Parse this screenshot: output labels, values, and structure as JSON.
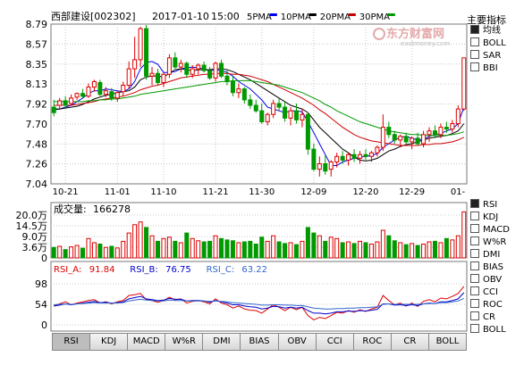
{
  "header": {
    "stock_title": "西部建设[002302]",
    "date": "2017-01-10",
    "time": "15:00",
    "ma_labels": [
      {
        "label": "5PMA",
        "color": "#0000ee"
      },
      {
        "label": "10PMA",
        "color": "#000000"
      },
      {
        "label": "20PMA",
        "color": "#cc0000"
      },
      {
        "label": "30PMA",
        "color": "#009900"
      }
    ],
    "watermark_cn": "东方财富网",
    "watermark_en": "eastmoney.com"
  },
  "indicator_panel": {
    "title": "主要指标",
    "items": [
      {
        "label": "均线",
        "checked": true
      },
      {
        "label": "BOLL",
        "checked": false
      },
      {
        "label": "SAR",
        "checked": false
      },
      {
        "label": "BBI",
        "checked": false
      }
    ]
  },
  "sub_indicator_panel": {
    "items": [
      {
        "label": "RSI",
        "checked": true
      },
      {
        "label": "KDJ",
        "checked": false
      },
      {
        "label": "MACD",
        "checked": false
      },
      {
        "label": "W%R",
        "checked": false
      },
      {
        "label": "DMI",
        "checked": false
      },
      {
        "label": "BIAS",
        "checked": false
      },
      {
        "label": "OBV",
        "checked": false
      },
      {
        "label": "CCI",
        "checked": false
      },
      {
        "label": "ROC",
        "checked": false
      },
      {
        "label": "CR",
        "checked": false
      },
      {
        "label": "BOLL",
        "checked": false
      }
    ]
  },
  "tabs": [
    "RSI",
    "KDJ",
    "MACD",
    "W%R",
    "DMI",
    "BIAS",
    "OBV",
    "CCI",
    "ROC",
    "CR",
    "BOLL"
  ],
  "active_tab": "RSI",
  "colors": {
    "up": "#dd0000",
    "down": "#009900",
    "grid": "#c8c8c8",
    "rsi_a": "#dd0000",
    "rsi_b": "#0000cc",
    "rsi_c": "#3366cc"
  },
  "chart_data": [
    {
      "type": "candlestick",
      "ylim": [
        7.04,
        8.79
      ],
      "y_ticks": [
        "8.79",
        "8.57",
        "8.35",
        "8.13",
        "7.92",
        "7.70",
        "7.48",
        "7.26",
        "7.04"
      ],
      "x_tick_labels": [
        "10-21",
        "11-01",
        "11-10",
        "11-21",
        "11-30",
        "12-09",
        "12-20",
        "12-29",
        "01-"
      ],
      "ohlc": [
        [
          7.88,
          7.96,
          7.78,
          7.82
        ],
        [
          7.9,
          7.98,
          7.85,
          7.95
        ],
        [
          7.95,
          8.0,
          7.86,
          7.9
        ],
        [
          7.92,
          8.02,
          7.9,
          7.98
        ],
        [
          7.99,
          8.04,
          7.96,
          8.03
        ],
        [
          8.03,
          8.08,
          7.98,
          8.0
        ],
        [
          8.0,
          8.14,
          7.98,
          8.1
        ],
        [
          8.1,
          8.18,
          8.05,
          8.16
        ],
        [
          8.15,
          8.18,
          8.0,
          8.02
        ],
        [
          8.02,
          8.1,
          7.99,
          8.06
        ],
        [
          8.05,
          8.09,
          7.95,
          7.98
        ],
        [
          7.98,
          8.06,
          7.94,
          8.04
        ],
        [
          8.05,
          8.16,
          8.0,
          8.12
        ],
        [
          8.12,
          8.38,
          8.08,
          8.3
        ],
        [
          8.3,
          8.65,
          8.2,
          8.4
        ],
        [
          8.4,
          8.76,
          8.32,
          8.74
        ],
        [
          8.74,
          8.78,
          8.18,
          8.22
        ],
        [
          8.22,
          8.32,
          8.12,
          8.25
        ],
        [
          8.25,
          8.3,
          8.12,
          8.15
        ],
        [
          8.15,
          8.26,
          8.1,
          8.24
        ],
        [
          8.24,
          8.46,
          8.2,
          8.42
        ],
        [
          8.42,
          8.48,
          8.3,
          8.32
        ],
        [
          8.32,
          8.4,
          8.26,
          8.36
        ],
        [
          8.36,
          8.38,
          8.2,
          8.24
        ],
        [
          8.24,
          8.34,
          8.2,
          8.3
        ],
        [
          8.3,
          8.36,
          8.24,
          8.34
        ],
        [
          8.34,
          8.38,
          8.26,
          8.28
        ],
        [
          8.28,
          8.32,
          8.18,
          8.2
        ],
        [
          8.2,
          8.38,
          8.16,
          8.36
        ],
        [
          8.36,
          8.4,
          8.2,
          8.22
        ],
        [
          8.22,
          8.28,
          8.12,
          8.16
        ],
        [
          8.16,
          8.22,
          8.0,
          8.04
        ],
        [
          8.04,
          8.14,
          7.98,
          8.08
        ],
        [
          8.08,
          8.1,
          7.92,
          7.96
        ],
        [
          7.96,
          8.02,
          7.86,
          7.9
        ],
        [
          7.9,
          7.96,
          7.82,
          7.84
        ],
        [
          7.84,
          7.92,
          7.7,
          7.72
        ],
        [
          7.72,
          7.82,
          7.68,
          7.8
        ],
        [
          7.8,
          7.96,
          7.76,
          7.92
        ],
        [
          7.92,
          7.98,
          7.84,
          7.88
        ],
        [
          7.88,
          7.94,
          7.72,
          7.76
        ],
        [
          7.76,
          7.88,
          7.68,
          7.84
        ],
        [
          7.84,
          7.92,
          7.7,
          7.74
        ],
        [
          7.74,
          7.86,
          7.66,
          7.8
        ],
        [
          7.8,
          7.82,
          7.36,
          7.42
        ],
        [
          7.42,
          7.48,
          7.18,
          7.2
        ],
        [
          7.2,
          7.34,
          7.12,
          7.26
        ],
        [
          7.26,
          7.36,
          7.14,
          7.18
        ],
        [
          7.2,
          7.3,
          7.12,
          7.28
        ],
        [
          7.28,
          7.38,
          7.22,
          7.34
        ],
        [
          7.34,
          7.4,
          7.26,
          7.3
        ],
        [
          7.3,
          7.38,
          7.24,
          7.36
        ],
        [
          7.36,
          7.42,
          7.28,
          7.32
        ],
        [
          7.32,
          7.4,
          7.26,
          7.36
        ],
        [
          7.36,
          7.42,
          7.3,
          7.34
        ],
        [
          7.34,
          7.4,
          7.28,
          7.38
        ],
        [
          7.38,
          7.46,
          7.34,
          7.44
        ],
        [
          7.44,
          7.8,
          7.4,
          7.66
        ],
        [
          7.66,
          7.72,
          7.54,
          7.58
        ],
        [
          7.58,
          7.62,
          7.48,
          7.52
        ],
        [
          7.52,
          7.58,
          7.44,
          7.56
        ],
        [
          7.56,
          7.6,
          7.48,
          7.5
        ],
        [
          7.5,
          7.56,
          7.42,
          7.54
        ],
        [
          7.54,
          7.6,
          7.46,
          7.48
        ],
        [
          7.48,
          7.62,
          7.44,
          7.58
        ],
        [
          7.58,
          7.66,
          7.5,
          7.62
        ],
        [
          7.62,
          7.68,
          7.54,
          7.58
        ],
        [
          7.58,
          7.7,
          7.54,
          7.66
        ],
        [
          7.66,
          7.72,
          7.6,
          7.64
        ],
        [
          7.64,
          7.74,
          7.6,
          7.7
        ],
        [
          7.7,
          7.9,
          7.66,
          7.86
        ],
        [
          7.86,
          8.42,
          7.84,
          8.42
        ]
      ],
      "ma_lines": {
        "5PMA": [
          7.85,
          7.86,
          7.88,
          7.9,
          7.94,
          7.98,
          8.03,
          8.06,
          8.06,
          8.08,
          8.07,
          8.06,
          8.05,
          8.08,
          8.16,
          8.3,
          8.37,
          8.38,
          8.35,
          8.26,
          8.26,
          8.27,
          8.3,
          8.31,
          8.32,
          8.31,
          8.3,
          8.28,
          8.29,
          8.28,
          8.26,
          8.22,
          8.16,
          8.12,
          8.08,
          8.02,
          7.96,
          7.88,
          7.86,
          7.84,
          7.82,
          7.84,
          7.84,
          7.83,
          7.72,
          7.6,
          7.48,
          7.36,
          7.24,
          7.24,
          7.28,
          7.3,
          7.32,
          7.33,
          7.34,
          7.35,
          7.37,
          7.44,
          7.48,
          7.52,
          7.55,
          7.56,
          7.54,
          7.52,
          7.53,
          7.56,
          7.58,
          7.59,
          7.62,
          7.64,
          7.7,
          7.88
        ],
        "10PMA": [
          7.86,
          7.86,
          7.87,
          7.88,
          7.89,
          7.91,
          7.94,
          7.97,
          7.99,
          8.01,
          8.02,
          8.04,
          8.05,
          8.06,
          8.1,
          8.18,
          8.21,
          8.22,
          8.22,
          8.21,
          8.25,
          8.29,
          8.3,
          8.29,
          8.28,
          8.29,
          8.29,
          8.29,
          8.3,
          8.3,
          8.29,
          8.27,
          8.24,
          8.21,
          8.18,
          8.14,
          8.1,
          8.06,
          8.02,
          7.98,
          7.94,
          7.9,
          7.88,
          7.86,
          7.82,
          7.74,
          7.66,
          7.6,
          7.54,
          7.48,
          7.42,
          7.38,
          7.33,
          7.3,
          7.29,
          7.3,
          7.32,
          7.36,
          7.4,
          7.42,
          7.45,
          7.47,
          7.48,
          7.5,
          7.52,
          7.54,
          7.55,
          7.56,
          7.57,
          7.59,
          7.62,
          7.7
        ],
        "20PMA": [
          7.9,
          7.9,
          7.9,
          7.9,
          7.91,
          7.92,
          7.93,
          7.94,
          7.96,
          7.97,
          7.98,
          7.99,
          8.0,
          8.02,
          8.04,
          8.07,
          8.09,
          8.11,
          8.12,
          8.14,
          8.16,
          8.18,
          8.2,
          8.21,
          8.22,
          8.23,
          8.24,
          8.24,
          8.25,
          8.25,
          8.25,
          8.24,
          8.24,
          8.23,
          8.22,
          8.2,
          8.18,
          8.16,
          8.13,
          8.1,
          8.07,
          8.04,
          8.01,
          7.98,
          7.94,
          7.9,
          7.85,
          7.81,
          7.76,
          7.71,
          7.66,
          7.62,
          7.58,
          7.55,
          7.53,
          7.51,
          7.5,
          7.49,
          7.48,
          7.47,
          7.46,
          7.46,
          7.46,
          7.46,
          7.47,
          7.47,
          7.48,
          7.48,
          7.49,
          7.5,
          7.52,
          7.55
        ],
        "30PMA": [
          7.94,
          7.94,
          7.94,
          7.94,
          7.94,
          7.94,
          7.95,
          7.95,
          7.96,
          7.96,
          7.97,
          7.97,
          7.98,
          7.99,
          8.0,
          8.02,
          8.03,
          8.04,
          8.05,
          8.06,
          8.07,
          8.08,
          8.09,
          8.1,
          8.11,
          8.12,
          8.13,
          8.14,
          8.15,
          8.16,
          8.16,
          8.17,
          8.17,
          8.17,
          8.17,
          8.16,
          8.15,
          8.14,
          8.13,
          8.12,
          8.1,
          8.08,
          8.06,
          8.04,
          8.01,
          7.98,
          7.95,
          7.91,
          7.88,
          7.84,
          7.81,
          7.78,
          7.75,
          7.72,
          7.7,
          7.68,
          7.66,
          7.64,
          7.62,
          7.61,
          7.6,
          7.59,
          7.58,
          7.58,
          7.57,
          7.57,
          7.57,
          7.57,
          7.57,
          7.58,
          7.59,
          7.61
        ]
      }
    },
    {
      "type": "bar",
      "title": "成交量",
      "last_volume": "166278",
      "y_ticks": [
        "20.0万",
        "14.5万",
        "9.0万",
        "3.6万",
        "0"
      ],
      "ylim": [
        0,
        200000
      ],
      "values": [
        38000,
        42000,
        30000,
        40000,
        45000,
        35000,
        70000,
        55000,
        50000,
        38000,
        42000,
        36000,
        60000,
        90000,
        120000,
        130000,
        110000,
        80000,
        60000,
        70000,
        75000,
        60000,
        55000,
        90000,
        70000,
        62000,
        58000,
        60000,
        80000,
        70000,
        65000,
        62000,
        55000,
        58000,
        60000,
        50000,
        75000,
        60000,
        80000,
        58000,
        52000,
        55000,
        48000,
        60000,
        110000,
        90000,
        80000,
        60000,
        75000,
        70000,
        55000,
        58000,
        52000,
        60000,
        55000,
        50000,
        58000,
        100000,
        80000,
        62000,
        55000,
        48000,
        52000,
        45000,
        50000,
        58000,
        60000,
        55000,
        70000,
        65000,
        80000,
        166278
      ]
    },
    {
      "type": "line",
      "y_ticks": [
        "98",
        "54",
        "0"
      ],
      "ylim": [
        0,
        100
      ],
      "series": [
        {
          "name": "RSI_A",
          "last": "91.84",
          "values": [
            45,
            50,
            55,
            48,
            52,
            55,
            58,
            60,
            52,
            55,
            50,
            55,
            58,
            70,
            72,
            75,
            60,
            58,
            54,
            58,
            66,
            60,
            62,
            52,
            56,
            58,
            55,
            50,
            62,
            52,
            48,
            40,
            45,
            38,
            35,
            34,
            28,
            38,
            48,
            42,
            34,
            42,
            36,
            42,
            22,
            12,
            18,
            15,
            22,
            30,
            28,
            34,
            30,
            36,
            32,
            38,
            42,
            70,
            58,
            48,
            52,
            45,
            52,
            44,
            56,
            60,
            55,
            64,
            62,
            68,
            75,
            92
          ]
        },
        {
          "name": "RSI_B",
          "last": "76.75",
          "values": [
            45,
            47,
            50,
            48,
            50,
            52,
            54,
            56,
            53,
            54,
            52,
            53,
            55,
            62,
            65,
            68,
            62,
            60,
            58,
            59,
            63,
            61,
            61,
            57,
            58,
            58,
            57,
            54,
            58,
            55,
            52,
            48,
            48,
            45,
            43,
            42,
            38,
            40,
            44,
            43,
            40,
            42,
            40,
            42,
            34,
            28,
            28,
            26,
            28,
            31,
            31,
            33,
            32,
            34,
            33,
            35,
            37,
            50,
            50,
            47,
            48,
            46,
            48,
            46,
            50,
            52,
            51,
            55,
            55,
            58,
            62,
            77
          ]
        },
        {
          "name": "RSI_C",
          "last": "63.22",
          "values": [
            48,
            49,
            50,
            49,
            50,
            51,
            52,
            53,
            52,
            52,
            52,
            52,
            53,
            57,
            59,
            61,
            59,
            58,
            57,
            57,
            59,
            58,
            58,
            57,
            57,
            57,
            57,
            56,
            57,
            56,
            55,
            53,
            52,
            51,
            50,
            49,
            47,
            47,
            48,
            48,
            47,
            47,
            46,
            46,
            43,
            40,
            39,
            38,
            38,
            39,
            39,
            40,
            40,
            41,
            41,
            42,
            43,
            49,
            50,
            49,
            49,
            49,
            49,
            49,
            50,
            51,
            51,
            53,
            53,
            55,
            57,
            63
          ]
        }
      ]
    }
  ]
}
